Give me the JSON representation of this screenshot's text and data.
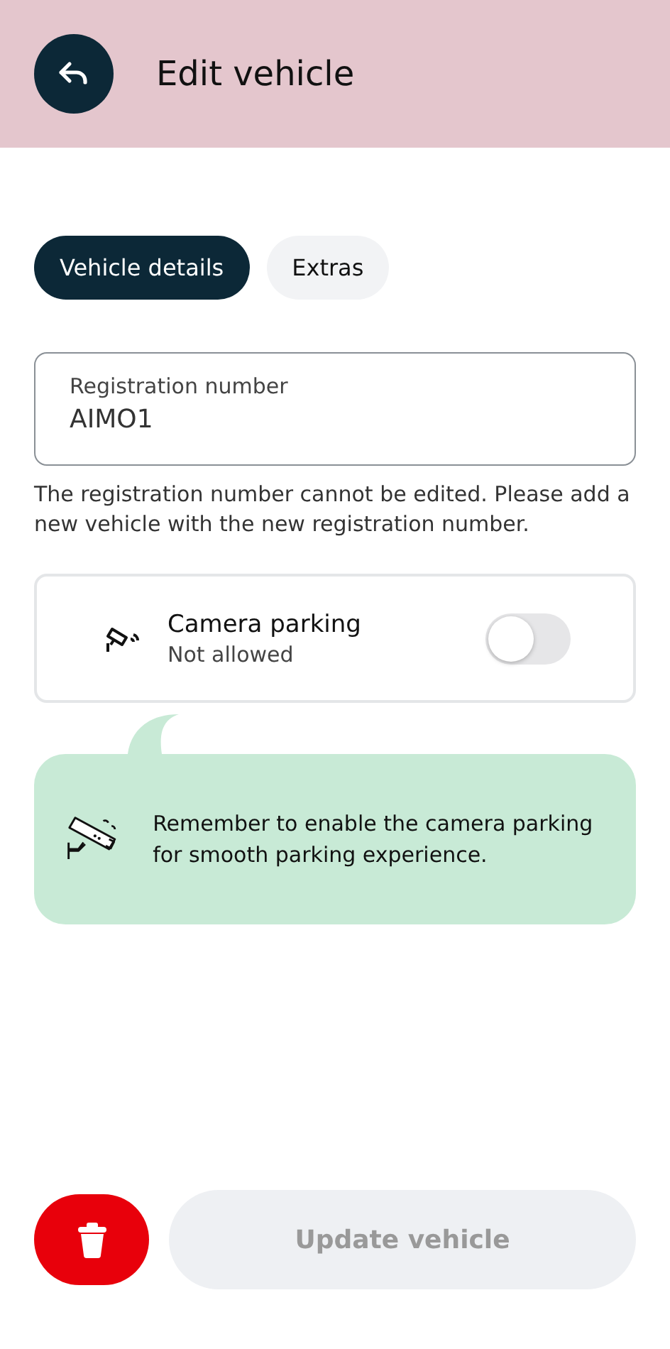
{
  "header": {
    "title": "Edit vehicle"
  },
  "tabs": [
    {
      "label": "Vehicle details",
      "selected": true
    },
    {
      "label": "Extras",
      "selected": false
    }
  ],
  "registration": {
    "label": "Registration number",
    "value": "AIMO1",
    "helper": "The registration number cannot be edited. Please add a new vehicle with the new registration number."
  },
  "camera_parking": {
    "title": "Camera parking",
    "status": "Not allowed",
    "on": false
  },
  "tip": {
    "text": "Remember to enable the camera parking for smooth parking experience."
  },
  "update_button": {
    "label": "Update vehicle",
    "disabled": true
  }
}
